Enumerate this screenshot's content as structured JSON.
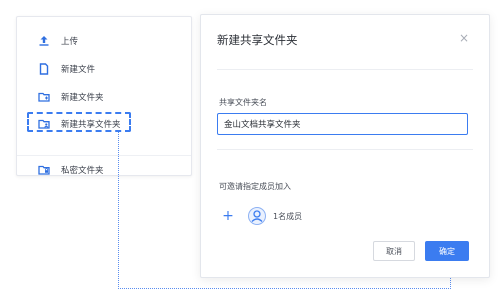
{
  "left_menu": {
    "items": [
      {
        "label": "上传",
        "icon": "upload-icon"
      },
      {
        "label": "新建文件",
        "icon": "new-file-icon"
      },
      {
        "label": "新建文件夹",
        "icon": "new-folder-icon"
      },
      {
        "label": "新建共享文件夹",
        "icon": "shared-folder-icon"
      },
      {
        "label": "私密文件夹",
        "icon": "private-folder-icon"
      }
    ]
  },
  "dialog": {
    "title": "新建共享文件夹",
    "close_symbol": "×",
    "field_label": "共享文件夹名",
    "field_value": "金山文档共享文件夹",
    "invite_label": "可邀请指定成员加入",
    "add_symbol": "+",
    "member_count": "1名成员",
    "cancel_label": "取消",
    "ok_label": "确定"
  },
  "colors": {
    "accent": "#3b7cf0",
    "text": "#3a3f4a",
    "border": "#e3e6ec"
  }
}
